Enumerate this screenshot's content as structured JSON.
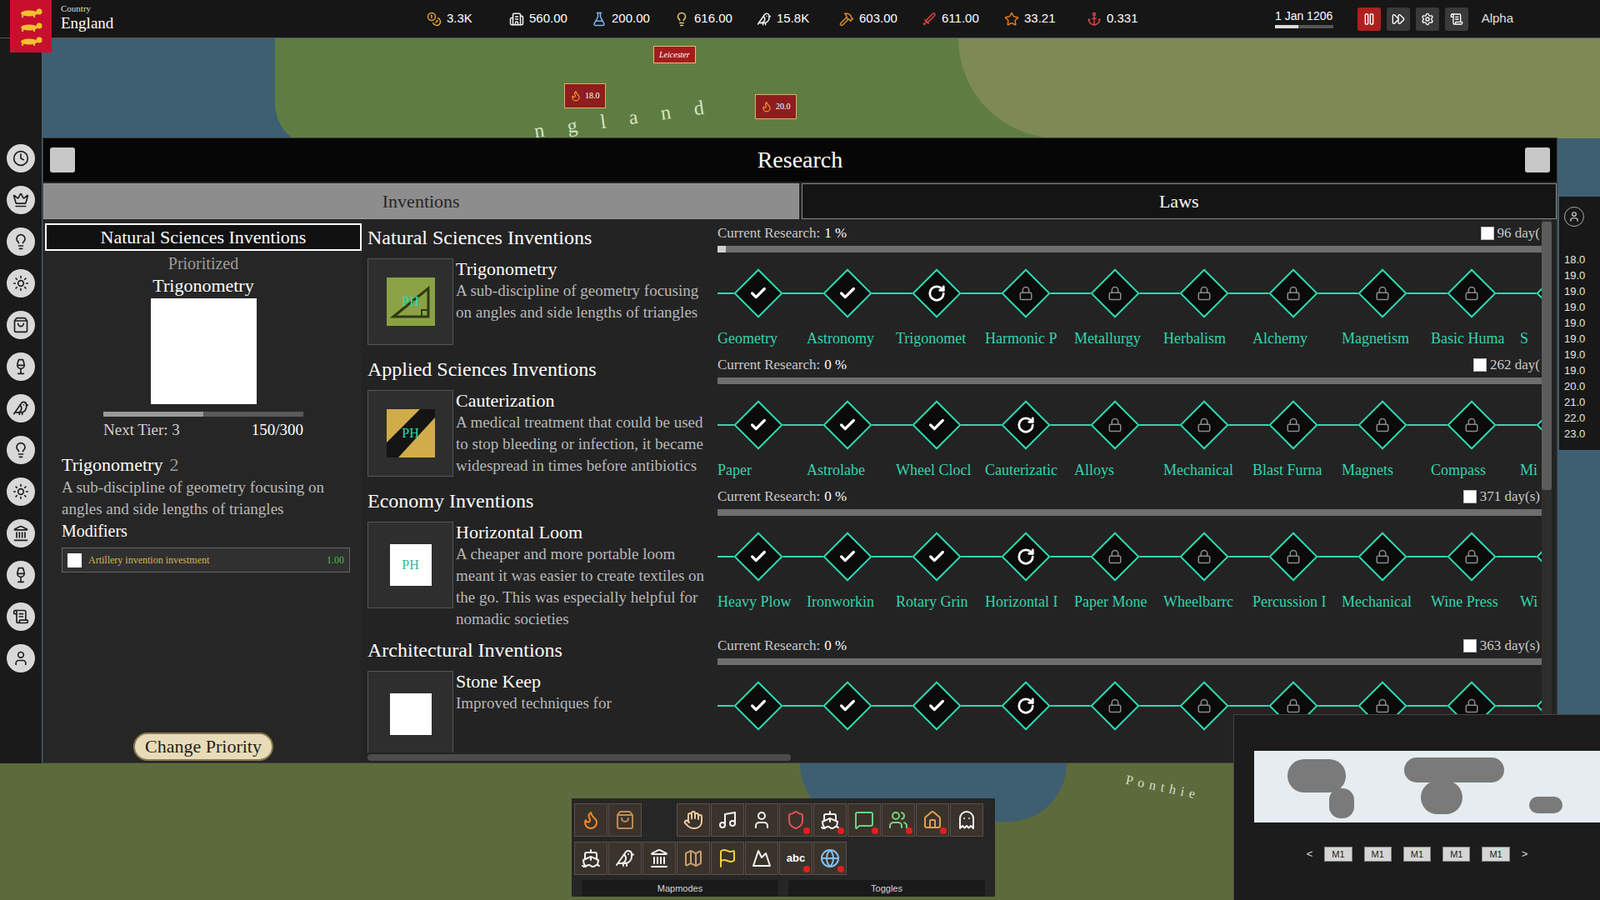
{
  "topbar": {
    "country_label": "Country",
    "country": "England",
    "resources": [
      {
        "kind": "gold",
        "value": "3.3K"
      },
      {
        "kind": "population",
        "value": "560.00"
      },
      {
        "kind": "science",
        "value": "200.00"
      },
      {
        "kind": "ideas",
        "value": "616.00"
      },
      {
        "kind": "manpower",
        "value": "15.8K"
      },
      {
        "kind": "production",
        "value": "603.00"
      },
      {
        "kind": "military",
        "value": "611.00"
      },
      {
        "kind": "prestige",
        "value": "33.21"
      },
      {
        "kind": "stability",
        "value": "0.331"
      }
    ],
    "date": "1 Jan 1206",
    "date_level": 0.4,
    "speed_buttons": [
      {
        "kind": "pause",
        "selected": true
      },
      {
        "kind": "fast",
        "selected": false
      },
      {
        "kind": "settings",
        "selected": false
      },
      {
        "kind": "ledger",
        "selected": false
      }
    ],
    "profile": "Alpha"
  },
  "map": {
    "labels": [
      {
        "kind": "banner",
        "text": "Leicester"
      },
      {
        "kind": "army",
        "text": "18.0"
      },
      {
        "kind": "army",
        "text": "20.0"
      },
      {
        "kind": "region",
        "text": "ngland"
      },
      {
        "kind": "place",
        "text": "Ponthie"
      }
    ]
  },
  "window": {
    "title": "Research"
  },
  "tabs": [
    {
      "label": "Inventions",
      "selected": true
    },
    {
      "label": "Laws",
      "selected": false
    }
  ],
  "priority": {
    "category": "Natural Sciences Inventions",
    "status": "Prioritized",
    "name": "Trigonometry",
    "level": 0.5,
    "next_tier_label": "Next Tier: 3",
    "progress": "150/300",
    "title": "Trigonometry",
    "tier": "2",
    "description": "A sub-discipline of geometry focusing on angles and side lengths of triangles",
    "modifiers_label": "Modifiers",
    "modifiers": [
      {
        "label": "Artillery invention investment",
        "value": "1.00",
        "checked": false
      }
    ],
    "button": "Change Priority"
  },
  "categories": [
    {
      "title": "Natural Sciences Inventions",
      "current": {
        "name": "Trigonometry",
        "description": "A sub-discipline of geometry focusing on angles and side lengths of triangles",
        "icon_text": "PH",
        "picture": "triangle"
      },
      "research_label": "Current Research:",
      "research_value": "1 %",
      "level": 0.01,
      "days": "96 day(",
      "days_checked": false,
      "nodes": [
        {
          "label": "Geometry",
          "state": "done"
        },
        {
          "label": "Astronomy",
          "state": "done"
        },
        {
          "label": "Trigonomet",
          "state": "active"
        },
        {
          "label": "Harmonic P",
          "state": "locked"
        },
        {
          "label": "Metallurgy",
          "state": "locked"
        },
        {
          "label": "Herbalism",
          "state": "locked"
        },
        {
          "label": "Alchemy",
          "state": "locked"
        },
        {
          "label": "Magnetism",
          "state": "locked"
        },
        {
          "label": "Basic Huma",
          "state": "locked"
        },
        {
          "label": "S",
          "state": "locked"
        }
      ]
    },
    {
      "title": "Applied Sciences Inventions",
      "current": {
        "name": "Cauterization",
        "description": "A medical treatment that could be used to stop bleeding or infection, it became widespread in times before antibiotics",
        "icon_text": "PH",
        "picture": "cautery"
      },
      "research_label": "Current Research:",
      "research_value": "0 %",
      "level": 0,
      "days": "262 day(",
      "days_checked": false,
      "nodes": [
        {
          "label": "Paper",
          "state": "done"
        },
        {
          "label": "Astrolabe",
          "state": "done"
        },
        {
          "label": "Wheel Clocl",
          "state": "done"
        },
        {
          "label": "Cauterizatic",
          "state": "active"
        },
        {
          "label": "Alloys",
          "state": "locked"
        },
        {
          "label": "Mechanical",
          "state": "locked"
        },
        {
          "label": "Blast Furna",
          "state": "locked"
        },
        {
          "label": "Magnets",
          "state": "locked"
        },
        {
          "label": "Compass",
          "state": "locked"
        },
        {
          "label": "Mi",
          "state": "locked"
        }
      ]
    },
    {
      "title": "Economy Inventions",
      "current": {
        "name": "Horizontal Loom",
        "description": "A cheaper and more portable loom meant it was easier to create textiles on the go. This was especially helpful for nomadic societies",
        "icon_text": "PH",
        "picture": "blank"
      },
      "research_label": "Current Research:",
      "research_value": "0 %",
      "level": 0,
      "days": "371 day(s)",
      "days_checked": false,
      "nodes": [
        {
          "label": "Heavy Plow",
          "state": "done"
        },
        {
          "label": "Ironworkin",
          "state": "done"
        },
        {
          "label": "Rotary Grin",
          "state": "done"
        },
        {
          "label": "Horizontal I",
          "state": "active"
        },
        {
          "label": "Paper Mone",
          "state": "locked"
        },
        {
          "label": "Wheelbarrc",
          "state": "locked"
        },
        {
          "label": "Percussion I",
          "state": "locked"
        },
        {
          "label": "Mechanical",
          "state": "locked"
        },
        {
          "label": "Wine Press",
          "state": "locked"
        },
        {
          "label": "Wi",
          "state": "locked"
        }
      ]
    },
    {
      "title": "Architectural Inventions",
      "current": {
        "name": "Stone Keep",
        "description": "Improved techniques for",
        "icon_text": "",
        "picture": "blank"
      },
      "research_label": "Current Research:",
      "research_value": "0 %",
      "level": 0,
      "days": "363 day(s)",
      "days_checked": false,
      "nodes": [
        {
          "label": "",
          "state": "done"
        },
        {
          "label": "",
          "state": "done"
        },
        {
          "label": "",
          "state": "done"
        },
        {
          "label": "",
          "state": "active"
        },
        {
          "label": "",
          "state": "locked"
        },
        {
          "label": "",
          "state": "locked"
        },
        {
          "label": "",
          "state": "locked"
        },
        {
          "label": "",
          "state": "locked"
        },
        {
          "label": "",
          "state": "locked"
        },
        {
          "label": "",
          "state": "locked"
        }
      ]
    }
  ],
  "side_stats": [
    "18.0",
    "19.0",
    "19.0",
    "19.0",
    "19.0",
    "19.0",
    "19.0",
    "19.0",
    "20.0",
    "21.0",
    "22.0",
    "23.0"
  ],
  "toolbar": {
    "rows": [
      [
        {
          "kind": "fire",
          "alert": false
        },
        {
          "kind": "bag",
          "alert": false
        },
        {
          "kind": "empty",
          "alert": false
        },
        {
          "kind": "hands",
          "alert": false
        },
        {
          "kind": "music",
          "alert": false
        },
        {
          "kind": "person",
          "alert": false
        },
        {
          "kind": "soldier",
          "alert": true
        },
        {
          "kind": "ship",
          "alert": true
        },
        {
          "kind": "chat",
          "alert": true
        },
        {
          "kind": "leader",
          "alert": true
        },
        {
          "kind": "house",
          "alert": true
        },
        {
          "kind": "ghost",
          "alert": false
        }
      ],
      [
        {
          "kind": "fleet",
          "alert": false
        },
        {
          "kind": "bird",
          "alert": false
        },
        {
          "kind": "temple",
          "alert": false
        },
        {
          "kind": "terrain",
          "alert": false
        },
        {
          "kind": "flag",
          "alert": false
        },
        {
          "kind": "mountain",
          "alert": false
        },
        {
          "kind": "language",
          "alert": true,
          "text": "abc"
        },
        {
          "kind": "globe",
          "alert": true
        }
      ]
    ],
    "tabs": [
      "Mapmodes",
      "Toggles"
    ]
  },
  "minimap": {
    "buttons": [
      "<",
      "M1",
      "M1",
      "M1",
      "M1",
      "M1",
      ">"
    ]
  }
}
